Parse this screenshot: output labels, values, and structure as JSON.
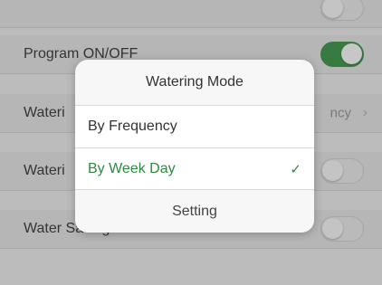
{
  "settings": {
    "rows": [
      {
        "label": ""
      },
      {
        "label": "Program ON/OFF"
      },
      {
        "label": "Wateri",
        "value": "ncy"
      },
      {
        "label": "Wateri"
      },
      {
        "label": "Water Saving Eco"
      }
    ]
  },
  "modal": {
    "title": "Watering Mode",
    "options": [
      {
        "label": "By Frequency",
        "selected": false
      },
      {
        "label": "By Week Day",
        "selected": true
      }
    ],
    "check_icon": "✓",
    "footer": "Setting"
  },
  "icons": {
    "chevron": "›"
  },
  "colors": {
    "accent": "#2e8b3e"
  }
}
